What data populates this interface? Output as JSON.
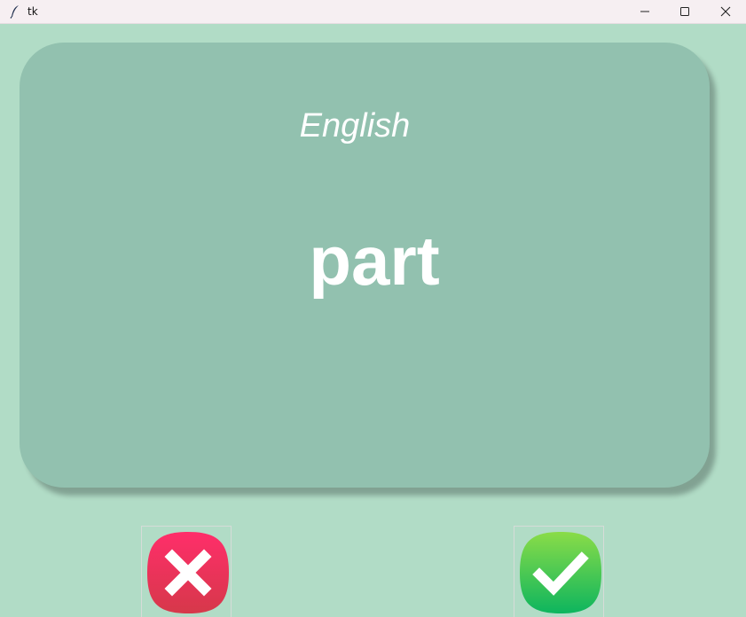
{
  "window": {
    "title": "tk",
    "icon": "feather-icon",
    "controls": [
      "minimize-icon",
      "maximize-icon",
      "close-icon"
    ]
  },
  "card": {
    "language": "English",
    "word": "part",
    "color": "#92c1af"
  },
  "background_color": "#b1dcc6",
  "actions": {
    "wrong": {
      "icon": "cross-icon",
      "color": "#e8335a"
    },
    "right": {
      "icon": "checkmark-icon",
      "color": "#1ec85f"
    }
  }
}
